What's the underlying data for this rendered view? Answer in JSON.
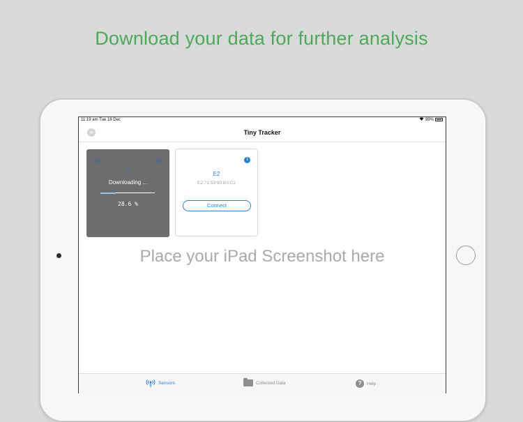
{
  "headline": "Download your data for further analysis",
  "status_bar": {
    "time": "11:19 am   Tue 18 Dec",
    "battery": "99%"
  },
  "nav": {
    "title": "Tiny Tracker",
    "add_icon": "plus-circle-icon"
  },
  "downloading_card": {
    "label": "Downloading ...",
    "percent_text": "28.6 %",
    "progress": 0.286,
    "progress_color": "#9cc2e8"
  },
  "sensor_card": {
    "name": "E2",
    "mac": "E2:71:59:90:B3:C2",
    "connect_label": "Connect",
    "info_icon": "info-icon"
  },
  "placeholder_text": "Place your iPad Screenshot here",
  "tabs": [
    {
      "label": "Sensors",
      "icon": "antenna-icon",
      "active": true
    },
    {
      "label": "Collected Data",
      "icon": "folder-icon",
      "active": false
    },
    {
      "label": "Help",
      "icon": "help-icon",
      "active": false
    }
  ],
  "colors": {
    "accent": "#2a7ed8",
    "headline": "#4ea85a",
    "card_dark": "#6d6d6d"
  }
}
